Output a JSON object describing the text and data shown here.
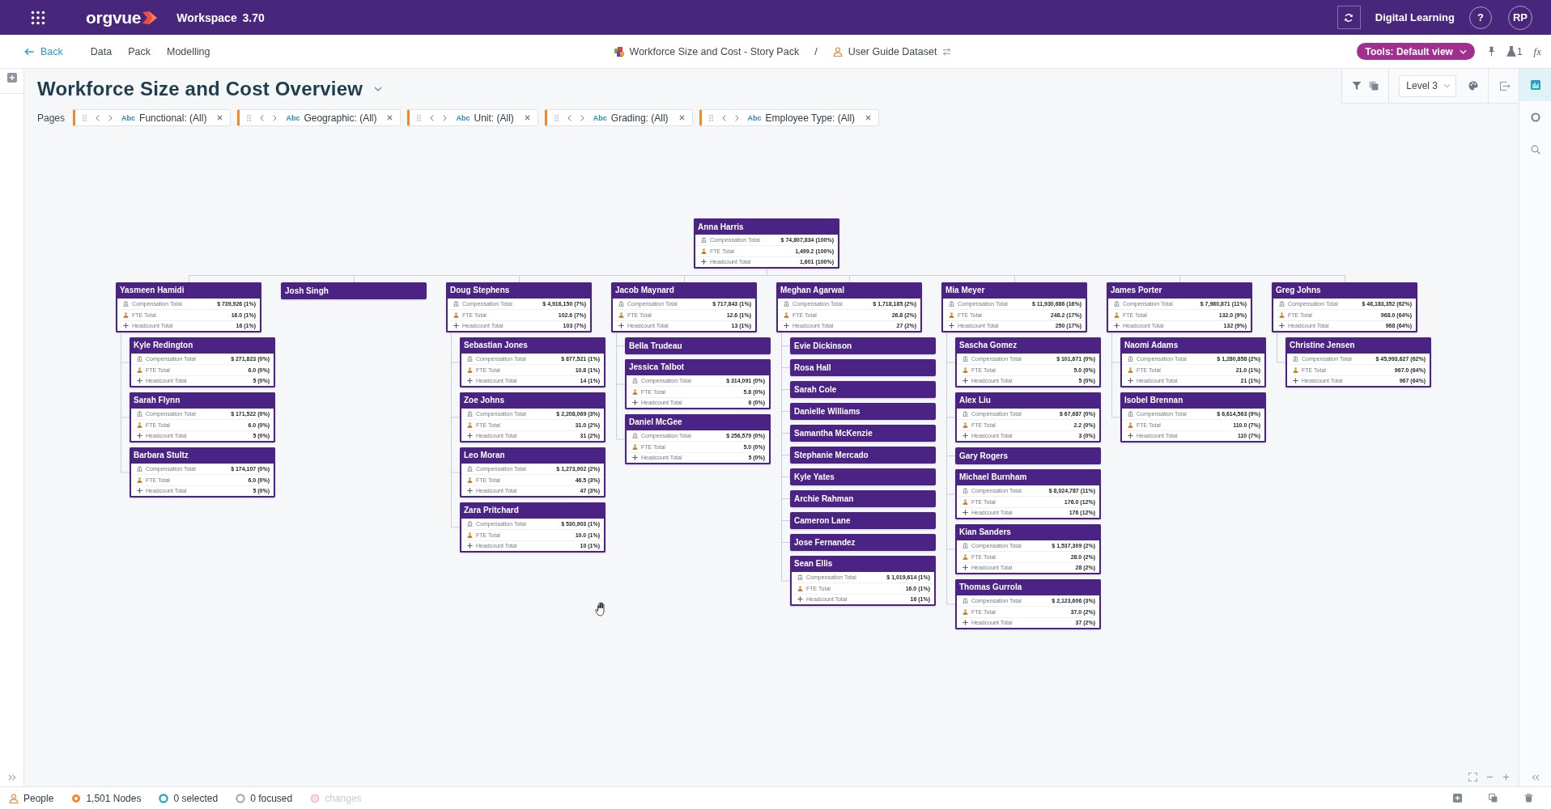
{
  "top_bar": {
    "logo": "orgvue",
    "workspace": "Workspace 3.70",
    "account": "Digital Learning",
    "help": "?",
    "avatar": "RP"
  },
  "nav_bar": {
    "back": "Back",
    "menu": [
      "Data",
      "Pack",
      "Modelling"
    ],
    "breadcrumb": [
      {
        "kind": "pack",
        "label": "Workforce Size and Cost - Story Pack"
      },
      {
        "kind": "dataset",
        "label": "User Guide Dataset"
      }
    ],
    "separator": "/",
    "tools_button": "Tools: Default view",
    "scenario_count": "1",
    "formula": "fx"
  },
  "page": {
    "title": "Workforce Size and Cost Overview",
    "pages_label": "Pages",
    "filters": [
      {
        "type": "Abc",
        "label": "Functional: (All)"
      },
      {
        "type": "Abc",
        "label": "Geographic: (All)"
      },
      {
        "type": "Abc",
        "label": "Unit: (All)"
      },
      {
        "type": "Abc",
        "label": "Grading: (All)"
      },
      {
        "type": "Abc",
        "label": "Employee Type: (All)"
      }
    ]
  },
  "view_tools": {
    "level": "Level 3"
  },
  "side_panel": {
    "tabs": [
      {
        "kind": "chart",
        "selected": true
      },
      {
        "kind": "ring",
        "selected": false
      },
      {
        "kind": "search",
        "selected": false
      }
    ]
  },
  "org_chart": {
    "root": {
      "name": "Anna Harris",
      "stats": [
        {
          "kind": "compensation",
          "label": "Compensation Total",
          "value": "$ 74,807,834 (100%)"
        },
        {
          "kind": "fte",
          "label": "FTE Total",
          "value": "1,499.2 (100%)"
        },
        {
          "kind": "headcount",
          "label": "Headcount Total",
          "value": "1,601 (100%)"
        }
      ],
      "children": [
        {
          "name": "Yasmeen Hamidi",
          "stats": [
            {
              "kind": "compensation",
              "label": "Compensation Total",
              "value": "$ 739,926 (1%)"
            },
            {
              "kind": "fte",
              "label": "FTE Total",
              "value": "16.0 (1%)"
            },
            {
              "kind": "headcount",
              "label": "Headcount Total",
              "value": "16 (1%)"
            }
          ],
          "children": [
            {
              "name": "Kyle Redington",
              "stats": [
                {
                  "kind": "compensation",
                  "label": "Compensation Total",
                  "value": "$ 271,823 (0%)"
                },
                {
                  "kind": "fte",
                  "label": "FTE Total",
                  "value": "6.0 (0%)"
                },
                {
                  "kind": "headcount",
                  "label": "Headcount Total",
                  "value": "5 (0%)"
                }
              ]
            },
            {
              "name": "Sarah Flynn",
              "stats": [
                {
                  "kind": "compensation",
                  "label": "Compensation Total",
                  "value": "$ 171,522 (0%)"
                },
                {
                  "kind": "fte",
                  "label": "FTE Total",
                  "value": "6.0 (0%)"
                },
                {
                  "kind": "headcount",
                  "label": "Headcount Total",
                  "value": "5 (0%)"
                }
              ]
            },
            {
              "name": "Barbara Stultz",
              "stats": [
                {
                  "kind": "compensation",
                  "label": "Compensation Total",
                  "value": "$ 174,107 (0%)"
                },
                {
                  "kind": "fte",
                  "label": "FTE Total",
                  "value": "6.0 (0%)"
                },
                {
                  "kind": "headcount",
                  "label": "Headcount Total",
                  "value": "5 (0%)"
                }
              ]
            }
          ]
        },
        {
          "name": "Josh Singh"
        },
        {
          "name": "Doug Stephens",
          "stats": [
            {
              "kind": "compensation",
              "label": "Compensation Total",
              "value": "$ 4,916,150 (7%)"
            },
            {
              "kind": "fte",
              "label": "FTE Total",
              "value": "102.6 (7%)"
            },
            {
              "kind": "headcount",
              "label": "Headcount Total",
              "value": "103 (7%)"
            }
          ],
          "children": [
            {
              "name": "Sebastian Jones",
              "stats": [
                {
                  "kind": "compensation",
                  "label": "Compensation Total",
                  "value": "$ 877,521 (1%)"
                },
                {
                  "kind": "fte",
                  "label": "FTE Total",
                  "value": "10.8 (1%)"
                },
                {
                  "kind": "headcount",
                  "label": "Headcount Total",
                  "value": "14 (1%)"
                }
              ]
            },
            {
              "name": "Zoe Johns",
              "stats": [
                {
                  "kind": "compensation",
                  "label": "Compensation Total",
                  "value": "$ 2,208,069 (3%)"
                },
                {
                  "kind": "fte",
                  "label": "FTE Total",
                  "value": "31.0 (2%)"
                },
                {
                  "kind": "headcount",
                  "label": "Headcount Total",
                  "value": "31 (2%)"
                }
              ]
            },
            {
              "name": "Leo Moran",
              "stats": [
                {
                  "kind": "compensation",
                  "label": "Compensation Total",
                  "value": "$ 1,273,902 (2%)"
                },
                {
                  "kind": "fte",
                  "label": "FTE Total",
                  "value": "46.5 (3%)"
                },
                {
                  "kind": "headcount",
                  "label": "Headcount Total",
                  "value": "47 (3%)"
                }
              ]
            },
            {
              "name": "Zara Pritchard",
              "stats": [
                {
                  "kind": "compensation",
                  "label": "Compensation Total",
                  "value": "$ 530,903 (1%)"
                },
                {
                  "kind": "fte",
                  "label": "FTE Total",
                  "value": "10.0 (1%)"
                },
                {
                  "kind": "headcount",
                  "label": "Headcount Total",
                  "value": "10 (1%)"
                }
              ]
            }
          ]
        },
        {
          "name": "Jacob Maynard",
          "stats": [
            {
              "kind": "compensation",
              "label": "Compensation Total",
              "value": "$ 717,843 (1%)"
            },
            {
              "kind": "fte",
              "label": "FTE Total",
              "value": "12.6 (1%)"
            },
            {
              "kind": "headcount",
              "label": "Headcount Total",
              "value": "13 (1%)"
            }
          ],
          "children": [
            {
              "name": "Bella Trudeau"
            },
            {
              "name": "Jessica Talbot",
              "stats": [
                {
                  "kind": "compensation",
                  "label": "Compensation Total",
                  "value": "$ 314,091 (0%)"
                },
                {
                  "kind": "fte",
                  "label": "FTE Total",
                  "value": "5.8 (0%)"
                },
                {
                  "kind": "headcount",
                  "label": "Headcount Total",
                  "value": "6 (0%)"
                }
              ]
            },
            {
              "name": "Daniel McGee",
              "stats": [
                {
                  "kind": "compensation",
                  "label": "Compensation Total",
                  "value": "$ 256,579 (0%)"
                },
                {
                  "kind": "fte",
                  "label": "FTE Total",
                  "value": "5.0 (0%)"
                },
                {
                  "kind": "headcount",
                  "label": "Headcount Total",
                  "value": "5 (0%)"
                }
              ]
            }
          ]
        },
        {
          "name": "Meghan Agarwal",
          "stats": [
            {
              "kind": "compensation",
              "label": "Compensation Total",
              "value": "$ 1,718,185 (2%)"
            },
            {
              "kind": "fte",
              "label": "FTE Total",
              "value": "26.8 (2%)"
            },
            {
              "kind": "headcount",
              "label": "Headcount Total",
              "value": "27 (2%)"
            }
          ],
          "children": [
            {
              "name": "Evie Dickinson"
            },
            {
              "name": "Rosa Hall"
            },
            {
              "name": "Sarah Cole"
            },
            {
              "name": "Danielle Williams"
            },
            {
              "name": "Samantha McKenzie"
            },
            {
              "name": "Stephanie Mercado"
            },
            {
              "name": "Kyle Yates"
            },
            {
              "name": "Archie Rahman"
            },
            {
              "name": "Cameron Lane"
            },
            {
              "name": "Jose Fernandez"
            },
            {
              "name": "Sean Ellis",
              "stats": [
                {
                  "kind": "compensation",
                  "label": "Compensation Total",
                  "value": "$ 1,019,614 (1%)"
                },
                {
                  "kind": "fte",
                  "label": "FTE Total",
                  "value": "16.0 (1%)"
                },
                {
                  "kind": "headcount",
                  "label": "Headcount Total",
                  "value": "16 (1%)"
                }
              ]
            }
          ]
        },
        {
          "name": "Mia Meyer",
          "stats": [
            {
              "kind": "compensation",
              "label": "Compensation Total",
              "value": "$ 11,930,686 (16%)"
            },
            {
              "kind": "fte",
              "label": "FTE Total",
              "value": "248.2 (17%)"
            },
            {
              "kind": "headcount",
              "label": "Headcount Total",
              "value": "250 (17%)"
            }
          ],
          "children": [
            {
              "name": "Sascha Gomez",
              "stats": [
                {
                  "kind": "compensation",
                  "label": "Compensation Total",
                  "value": "$ 101,671 (0%)"
                },
                {
                  "kind": "fte",
                  "label": "FTE Total",
                  "value": "5.0 (0%)"
                },
                {
                  "kind": "headcount",
                  "label": "Headcount Total",
                  "value": "5 (0%)"
                }
              ]
            },
            {
              "name": "Alex Liu",
              "stats": [
                {
                  "kind": "compensation",
                  "label": "Compensation Total",
                  "value": "$ 67,687 (0%)"
                },
                {
                  "kind": "fte",
                  "label": "FTE Total",
                  "value": "2.2 (0%)"
                },
                {
                  "kind": "headcount",
                  "label": "Headcount Total",
                  "value": "3 (0%)"
                }
              ]
            },
            {
              "name": "Gary Rogers"
            },
            {
              "name": "Michael Burnham",
              "stats": [
                {
                  "kind": "compensation",
                  "label": "Compensation Total",
                  "value": "$ 8,024,787 (11%)"
                },
                {
                  "kind": "fte",
                  "label": "FTE Total",
                  "value": "176.0 (12%)"
                },
                {
                  "kind": "headcount",
                  "label": "Headcount Total",
                  "value": "176 (12%)"
                }
              ]
            },
            {
              "name": "Kian Sanders",
              "stats": [
                {
                  "kind": "compensation",
                  "label": "Compensation Total",
                  "value": "$ 1,537,309 (2%)"
                },
                {
                  "kind": "fte",
                  "label": "FTE Total",
                  "value": "28.0 (2%)"
                },
                {
                  "kind": "headcount",
                  "label": "Headcount Total",
                  "value": "28 (2%)"
                }
              ]
            },
            {
              "name": "Thomas Gurrola",
              "stats": [
                {
                  "kind": "compensation",
                  "label": "Compensation Total",
                  "value": "$ 2,123,606 (3%)"
                },
                {
                  "kind": "fte",
                  "label": "FTE Total",
                  "value": "37.0 (2%)"
                },
                {
                  "kind": "headcount",
                  "label": "Headcount Total",
                  "value": "37 (2%)"
                }
              ]
            }
          ]
        },
        {
          "name": "James Porter",
          "stats": [
            {
              "kind": "compensation",
              "label": "Compensation Total",
              "value": "$ 7,980,871 (11%)"
            },
            {
              "kind": "fte",
              "label": "FTE Total",
              "value": "132.0 (9%)"
            },
            {
              "kind": "headcount",
              "label": "Headcount Total",
              "value": "132 (9%)"
            }
          ],
          "children": [
            {
              "name": "Naomi Adams",
              "stats": [
                {
                  "kind": "compensation",
                  "label": "Compensation Total",
                  "value": "$ 1,280,858 (2%)"
                },
                {
                  "kind": "fte",
                  "label": "FTE Total",
                  "value": "21.0 (1%)"
                },
                {
                  "kind": "headcount",
                  "label": "Headcount Total",
                  "value": "21 (1%)"
                }
              ]
            },
            {
              "name": "Isobel Brennan",
              "stats": [
                {
                  "kind": "compensation",
                  "label": "Compensation Total",
                  "value": "$ 6,614,563 (9%)"
                },
                {
                  "kind": "fte",
                  "label": "FTE Total",
                  "value": "110.0 (7%)"
                },
                {
                  "kind": "headcount",
                  "label": "Headcount Total",
                  "value": "110 (7%)"
                }
              ]
            }
          ]
        },
        {
          "name": "Greg Johns",
          "stats": [
            {
              "kind": "compensation",
              "label": "Compensation Total",
              "value": "$ 46,183,352 (62%)"
            },
            {
              "kind": "fte",
              "label": "FTE Total",
              "value": "968.0 (64%)"
            },
            {
              "kind": "headcount",
              "label": "Headcount Total",
              "value": "968 (64%)"
            }
          ],
          "children": [
            {
              "name": "Christine Jensen",
              "stats": [
                {
                  "kind": "compensation",
                  "label": "Compensation Total",
                  "value": "$ 45,993,627 (62%)"
                },
                {
                  "kind": "fte",
                  "label": "FTE Total",
                  "value": "967.0 (64%)"
                },
                {
                  "kind": "headcount",
                  "label": "Headcount Total",
                  "value": "967 (64%)"
                }
              ]
            }
          ]
        }
      ]
    }
  },
  "status_bar": {
    "items": [
      {
        "kind": "people",
        "label": "People",
        "disabled": false
      },
      {
        "kind": "nodes",
        "label": "1,501 Nodes",
        "disabled": false
      },
      {
        "kind": "selected",
        "label": "0 selected",
        "disabled": false
      },
      {
        "kind": "focused",
        "label": "0 focused",
        "disabled": false
      },
      {
        "kind": "changes",
        "label": "changes",
        "disabled": true
      }
    ]
  }
}
